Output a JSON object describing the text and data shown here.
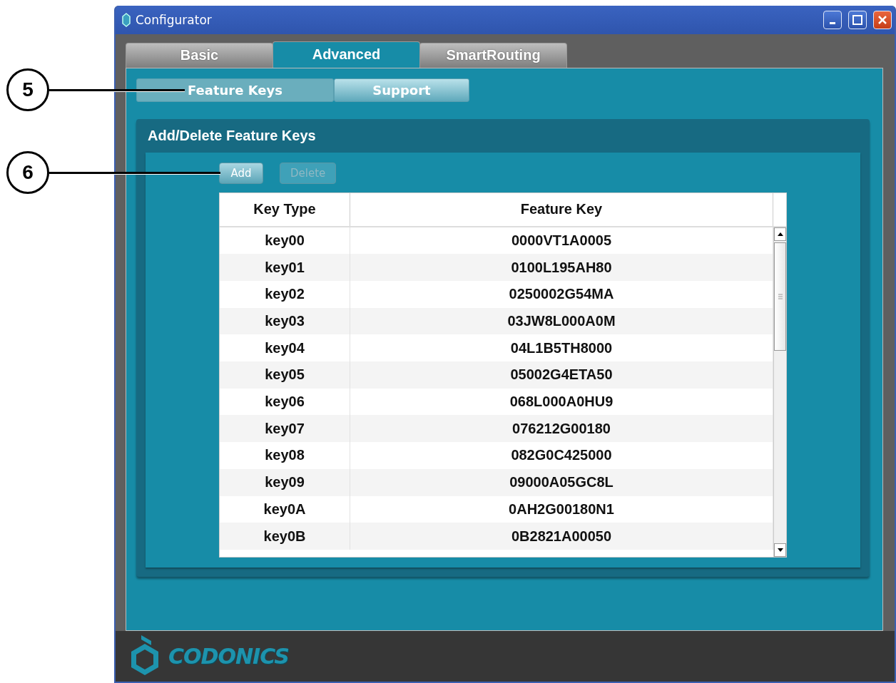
{
  "window": {
    "title": "Configurator"
  },
  "tabs": [
    {
      "label": "Basic",
      "selected": false
    },
    {
      "label": "Advanced",
      "selected": true
    },
    {
      "label": "SmartRouting",
      "selected": false
    }
  ],
  "subtabs": [
    {
      "label": "Feature Keys",
      "selected": true
    },
    {
      "label": "Support",
      "selected": false
    }
  ],
  "group": {
    "title": "Add/Delete Feature Keys",
    "buttons": [
      {
        "label": "Add",
        "disabled": false
      },
      {
        "label": "Delete",
        "disabled": true
      }
    ],
    "table": {
      "columns": [
        "Key Type",
        "Feature Key"
      ],
      "rows": [
        [
          "key00",
          "0000VT1A0005"
        ],
        [
          "key01",
          "0100L195AH80"
        ],
        [
          "key02",
          "0250002G54MA"
        ],
        [
          "key03",
          "03JW8L000A0M"
        ],
        [
          "key04",
          "04L1B5TH8000"
        ],
        [
          "key05",
          "05002G4ETA50"
        ],
        [
          "key06",
          "068L000A0HU9"
        ],
        [
          "key07",
          "076212G00180"
        ],
        [
          "key08",
          "082G0C425000"
        ],
        [
          "key09",
          "09000A05GC8L"
        ],
        [
          "key0A",
          "0AH2G00180N1"
        ],
        [
          "key0B",
          "0B2821A00050"
        ]
      ]
    }
  },
  "footer": {
    "logo_text": "CODONICS"
  },
  "callouts": [
    {
      "label": "5"
    },
    {
      "label": "6"
    }
  ]
}
